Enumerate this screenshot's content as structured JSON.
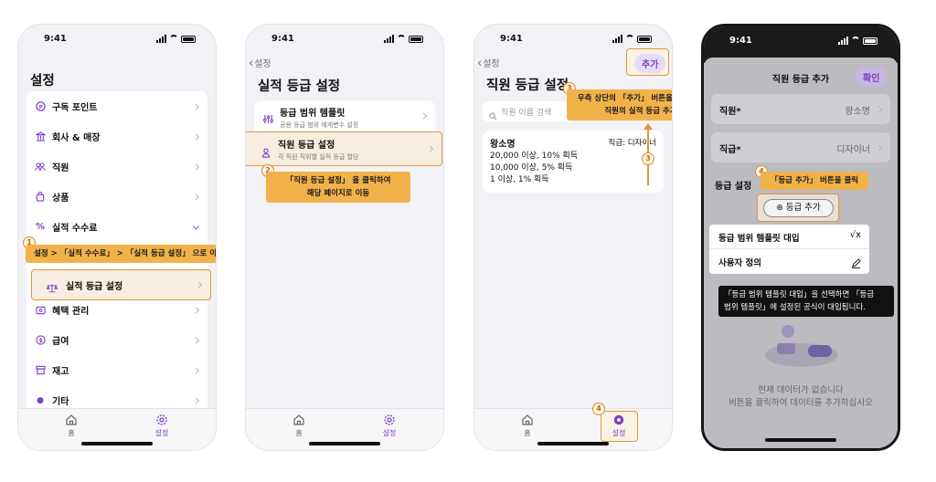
{
  "status_time": "9:41",
  "colors": {
    "accent": "#7a3fc4",
    "callout": "#f2b24a",
    "highlight_border": "#e0953c"
  },
  "screen1": {
    "title": "설정",
    "items": [
      {
        "label": "구독 포인트",
        "icon": "point-icon"
      },
      {
        "label": "회사 & 매장",
        "icon": "building-icon"
      },
      {
        "label": "직원",
        "icon": "people-icon"
      },
      {
        "label": "상품",
        "icon": "bag-icon"
      },
      {
        "label": "실적 수수료",
        "icon": "percent-icon"
      }
    ],
    "sub_item": "실적 등급 설정",
    "items2": [
      {
        "label": "혜택 관리",
        "icon": "ticket-icon"
      },
      {
        "label": "급여",
        "icon": "dollar-icon"
      },
      {
        "label": "재고",
        "icon": "box-icon"
      },
      {
        "label": "기타",
        "icon": "more-icon"
      }
    ],
    "step": "1",
    "callout": "설정 > 「실적 수수료」 > 「실적 등급 설정」 으로 이동"
  },
  "screen2": {
    "back": "설정",
    "title": "실적 등급 설정",
    "item1": {
      "title": "등급 범위 템플릿",
      "desc": "공용 등급 범위 에게변수 설정"
    },
    "item2": {
      "title": "직원 등급 설정",
      "desc": "각 직원 직위별 실적 등급 할당"
    },
    "step": "2",
    "callout_line1": "「직원 등급 설정」 을 클릭하여",
    "callout_line2": "해당 페이지로 이동"
  },
  "screen3": {
    "back": "설정",
    "title": "직원 등급 설정",
    "add_button": "추가",
    "search_placeholder": "직원 이름 검색",
    "employee": {
      "name": "왕소명",
      "position": "직급: 디자이너",
      "lines": [
        "20,000 이상, 10% 획득",
        "10,000 이상, 5% 획득",
        "1 이상, 1% 획득"
      ]
    },
    "step_top": "3",
    "step_mid": "3",
    "step_bottom": "4",
    "callout_line1": "우측 상단의 「추가」 버튼을 클릭하여",
    "callout_line2": "직원의 실적 등급 추가"
  },
  "tabs": {
    "home": "홈",
    "settings": "설정"
  },
  "screen4": {
    "title": "직원 등급 추가",
    "confirm": "확인",
    "field1_label": "직원*",
    "field1_value": "왕소명",
    "field2_label": "직급*",
    "field2_value": "디자이너",
    "section_label": "등급 설정",
    "add_grade_button": "등급 추가",
    "menu": [
      {
        "label": "등급 범위 템플릿 대입",
        "icon": "sqrt-icon"
      },
      {
        "label": "사용자 정의",
        "icon": "pen-icon"
      }
    ],
    "step": "4",
    "callout": "「등급 추가」 버튼을 클릭",
    "dark_line1": "「등급 범위 템플릿 대입」을 선택하면 「등급",
    "dark_line2": "범위 템플릿」에 설정된 공식이 대입됩니다.",
    "empty_line1": "현재 데이터가 없습니다",
    "empty_line2": "버튼을 클릭하여 데이터를 추가하십시오"
  }
}
